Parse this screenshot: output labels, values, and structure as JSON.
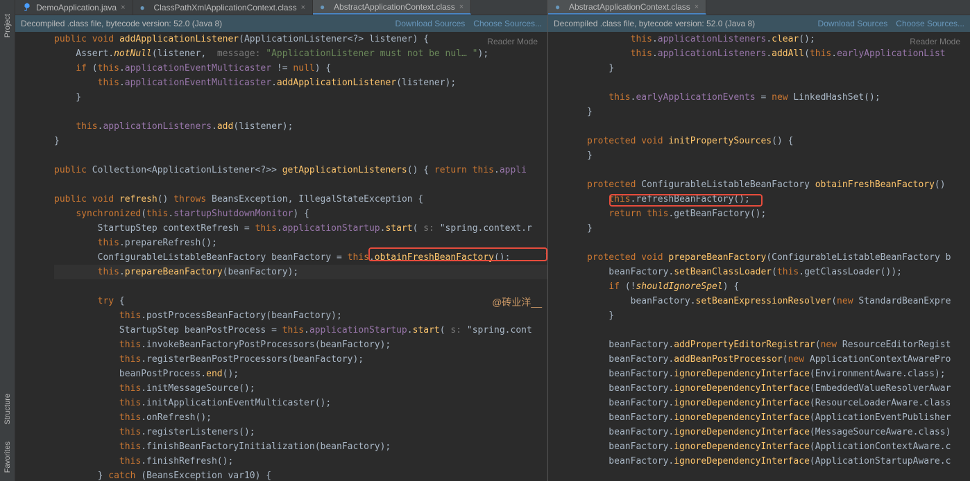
{
  "leftTools": [
    "Project",
    "Structure",
    "Favorites"
  ],
  "tabsLeft": [
    {
      "label": "DemoApplication.java",
      "active": false
    },
    {
      "label": "ClassPathXmlApplicationContext.class",
      "active": false
    },
    {
      "label": "AbstractApplicationContext.class",
      "active": true
    }
  ],
  "tabsRight": [
    {
      "label": "AbstractApplicationContext.class",
      "active": true
    }
  ],
  "infoBar": {
    "text": "Decompiled .class file, bytecode version: 52.0 (Java 8)",
    "downloadSources": "Download Sources",
    "chooseSources": "Choose Sources..."
  },
  "readerMode": "Reader Mode",
  "watermark": "@砖业洋__",
  "leftCode": [
    "public void addApplicationListener(ApplicationListener<?> listener) {",
    "    Assert.notNull(listener,  message: \"ApplicationListener must not be nul… \");",
    "    if (this.applicationEventMulticaster != null) {",
    "        this.applicationEventMulticaster.addApplicationListener(listener);",
    "    }",
    "",
    "    this.applicationListeners.add(listener);",
    "}",
    "",
    "public Collection<ApplicationListener<?>> getApplicationListeners() { return this.appli",
    "",
    "public void refresh() throws BeansException, IllegalStateException {",
    "    synchronized(this.startupShutdownMonitor) {",
    "        StartupStep contextRefresh = this.applicationStartup.start( s: \"spring.context.r",
    "        this.prepareRefresh();",
    "        ConfigurableListableBeanFactory beanFactory = this.obtainFreshBeanFactory();",
    "        this.prepareBeanFactory(beanFactory);",
    "",
    "        try {",
    "            this.postProcessBeanFactory(beanFactory);",
    "            StartupStep beanPostProcess = this.applicationStartup.start( s: \"spring.cont",
    "            this.invokeBeanFactoryPostProcessors(beanFactory);",
    "            this.registerBeanPostProcessors(beanFactory);",
    "            beanPostProcess.end();",
    "            this.initMessageSource();",
    "            this.initApplicationEventMulticaster();",
    "            this.onRefresh();",
    "            this.registerListeners();",
    "            this.finishBeanFactoryInitialization(beanFactory);",
    "            this.finishRefresh();",
    "        } catch (BeansException var10) {"
  ],
  "rightCode": [
    "        this.applicationListeners.clear();",
    "        this.applicationListeners.addAll(this.earlyApplicationList",
    "    }",
    "",
    "    this.earlyApplicationEvents = new LinkedHashSet();",
    "}",
    "",
    "protected void initPropertySources() {",
    "}",
    "",
    "protected ConfigurableListableBeanFactory obtainFreshBeanFactory()",
    "    this.refreshBeanFactory();",
    "    return this.getBeanFactory();",
    "}",
    "",
    "protected void prepareBeanFactory(ConfigurableListableBeanFactory b",
    "    beanFactory.setBeanClassLoader(this.getClassLoader());",
    "    if (!shouldIgnoreSpel) {",
    "        beanFactory.setBeanExpressionResolver(new StandardBeanExpre",
    "    }",
    "",
    "    beanFactory.addPropertyEditorRegistrar(new ResourceEditorRegist",
    "    beanFactory.addBeanPostProcessor(new ApplicationContextAwarePro",
    "    beanFactory.ignoreDependencyInterface(EnvironmentAware.class);",
    "    beanFactory.ignoreDependencyInterface(EmbeddedValueResolverAwar",
    "    beanFactory.ignoreDependencyInterface(ResourceLoaderAware.class",
    "    beanFactory.ignoreDependencyInterface(ApplicationEventPublisher",
    "    beanFactory.ignoreDependencyInterface(MessageSourceAware.class)",
    "    beanFactory.ignoreDependencyInterface(ApplicationContextAware.c",
    "    beanFactory.ignoreDependencyInterface(ApplicationStartupAware.c"
  ]
}
